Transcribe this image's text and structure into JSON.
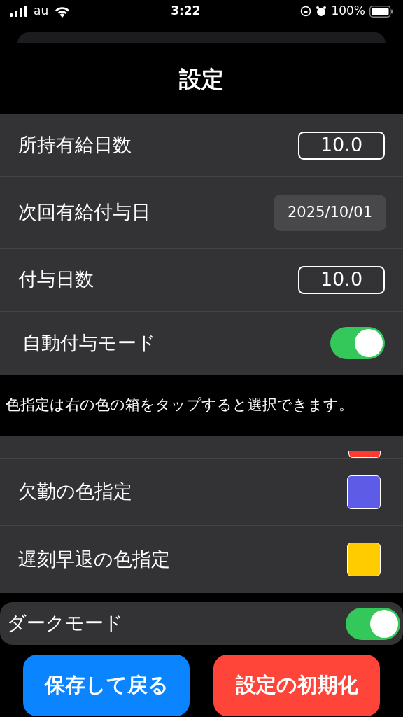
{
  "status_bar": {
    "carrier": "au",
    "time": "3:22",
    "battery": "100%"
  },
  "title": "設定",
  "settings": [
    {
      "kind": "number",
      "label": "所持有給日数",
      "value": "10.0"
    },
    {
      "kind": "date",
      "label": "次回有給付与日",
      "value": "2025/10/01"
    },
    {
      "kind": "number",
      "label": "付与日数",
      "value": "10.0"
    },
    {
      "kind": "toggle",
      "label": "自動付与モード",
      "on": true
    }
  ],
  "note": "色指定は右の色の箱をタップすると選択できます。",
  "color_section": {
    "partial_swatch": {
      "color": "#ff3b30"
    },
    "rows": [
      {
        "label": "欠勤の色指定",
        "color": "#5e5ce6"
      },
      {
        "label": "遅刻早退の色指定",
        "color": "#ffcc00"
      }
    ]
  },
  "dark_mode": {
    "label": "ダークモード",
    "on": true
  },
  "buttons": [
    {
      "kind": "primary",
      "label": "保存して戻る"
    },
    {
      "kind": "danger",
      "label": "設定の初期化"
    }
  ]
}
